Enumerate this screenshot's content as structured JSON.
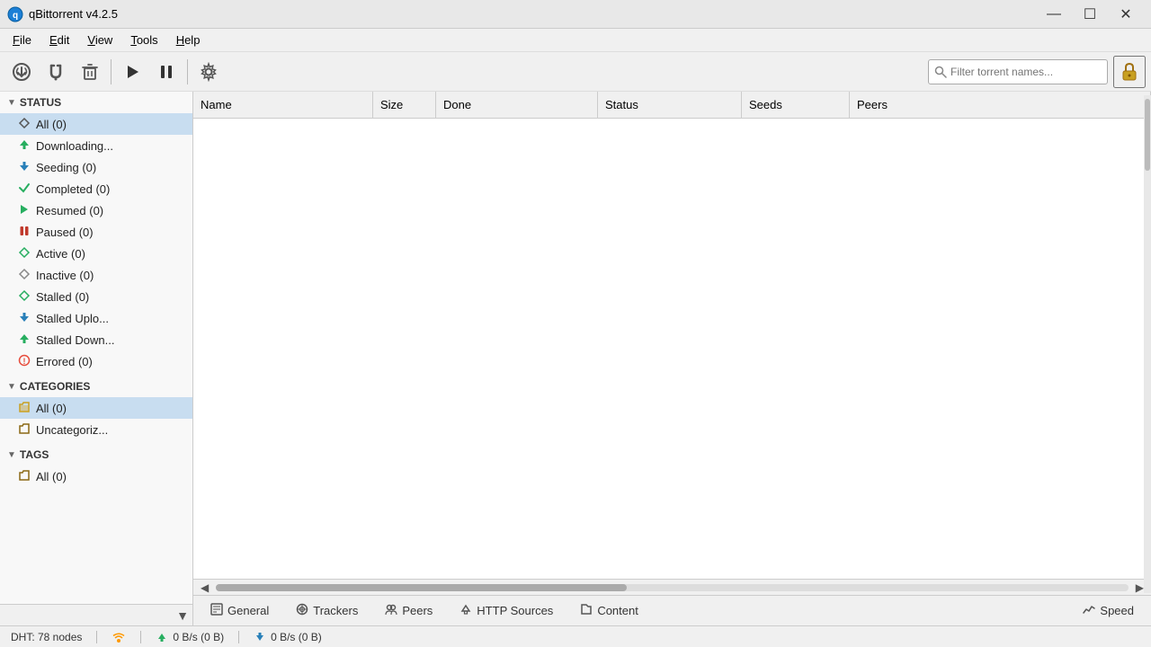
{
  "titleBar": {
    "title": "qBittorrent v4.2.5",
    "appIconUnicode": "🔵",
    "minimizeLabel": "—",
    "maximizeLabel": "☐",
    "closeLabel": "✕"
  },
  "menuBar": {
    "items": [
      {
        "id": "file",
        "label": "File",
        "underlineChar": "F"
      },
      {
        "id": "edit",
        "label": "Edit",
        "underlineChar": "E"
      },
      {
        "id": "view",
        "label": "View",
        "underlineChar": "V"
      },
      {
        "id": "tools",
        "label": "Tools",
        "underlineChar": "T"
      },
      {
        "id": "help",
        "label": "Help",
        "underlineChar": "H"
      }
    ]
  },
  "toolbar": {
    "buttons": [
      {
        "id": "add-torrent",
        "icon": "⊕",
        "tooltip": "Add torrent"
      },
      {
        "id": "add-magnet",
        "icon": "🔗",
        "tooltip": "Add magnet link"
      },
      {
        "id": "delete",
        "icon": "🗑",
        "tooltip": "Delete selected"
      },
      {
        "id": "resume",
        "icon": "▶",
        "tooltip": "Resume selected"
      },
      {
        "id": "pause",
        "icon": "⏸",
        "tooltip": "Pause selected"
      },
      {
        "id": "options",
        "icon": "⚙",
        "tooltip": "Options"
      }
    ],
    "searchPlaceholder": "Filter torrent names...",
    "lockIcon": "🔒"
  },
  "sidebar": {
    "statusSection": {
      "label": "STATUS",
      "items": [
        {
          "id": "all",
          "label": "All (0)",
          "iconType": "all",
          "selected": true
        },
        {
          "id": "downloading",
          "label": "Downloading...",
          "iconType": "downloading"
        },
        {
          "id": "seeding",
          "label": "Seeding (0)",
          "iconType": "seeding"
        },
        {
          "id": "completed",
          "label": "Completed (0)",
          "iconType": "completed"
        },
        {
          "id": "resumed",
          "label": "Resumed (0)",
          "iconType": "resumed"
        },
        {
          "id": "paused",
          "label": "Paused (0)",
          "iconType": "paused"
        },
        {
          "id": "active",
          "label": "Active (0)",
          "iconType": "active"
        },
        {
          "id": "inactive",
          "label": "Inactive (0)",
          "iconType": "inactive"
        },
        {
          "id": "stalled",
          "label": "Stalled (0)",
          "iconType": "stalled"
        },
        {
          "id": "stalled-upload",
          "label": "Stalled Uplo...",
          "iconType": "stalled-up"
        },
        {
          "id": "stalled-download",
          "label": "Stalled Down...",
          "iconType": "stalled-down"
        },
        {
          "id": "errored",
          "label": "Errored (0)",
          "iconType": "errored"
        }
      ]
    },
    "categoriesSection": {
      "label": "CATEGORIES",
      "items": [
        {
          "id": "cat-all",
          "label": "All (0)",
          "iconType": "folder-open",
          "selected": true
        },
        {
          "id": "uncategorized",
          "label": "Uncategoriz...",
          "iconType": "folder"
        }
      ]
    },
    "tagsSection": {
      "label": "TAGS",
      "items": [
        {
          "id": "tag-all",
          "label": "All (0)",
          "iconType": "folder"
        }
      ]
    }
  },
  "table": {
    "columns": [
      {
        "id": "name",
        "label": "Name"
      },
      {
        "id": "size",
        "label": "Size"
      },
      {
        "id": "done",
        "label": "Done"
      },
      {
        "id": "status",
        "label": "Status"
      },
      {
        "id": "seeds",
        "label": "Seeds"
      },
      {
        "id": "peers",
        "label": "Peers"
      }
    ],
    "rows": []
  },
  "bottomTabs": [
    {
      "id": "general",
      "label": "General",
      "icon": "📄"
    },
    {
      "id": "trackers",
      "label": "Trackers",
      "icon": "📡"
    },
    {
      "id": "peers",
      "label": "Peers",
      "icon": "👥"
    },
    {
      "id": "http-sources",
      "label": "HTTP Sources",
      "icon": "⬇"
    },
    {
      "id": "content",
      "label": "Content",
      "icon": "📁"
    },
    {
      "id": "speed",
      "label": "Speed",
      "icon": "📈"
    }
  ],
  "statusBar": {
    "dht": "DHT: 78 nodes",
    "downloadSpeed": "0 B/s (0 B)",
    "uploadSpeed": "0 B/s (0 B)"
  },
  "icons": {
    "all": "▼",
    "downloading": "▼",
    "seeding": "▲",
    "completed": "✔",
    "resumed": "▶",
    "paused": "⏸",
    "active": "▼",
    "inactive": "▼",
    "stalled": "▼",
    "stalled-up": "▲",
    "stalled-down": "▼",
    "errored": "❗",
    "folder": "📁",
    "folder-open": "📂"
  }
}
